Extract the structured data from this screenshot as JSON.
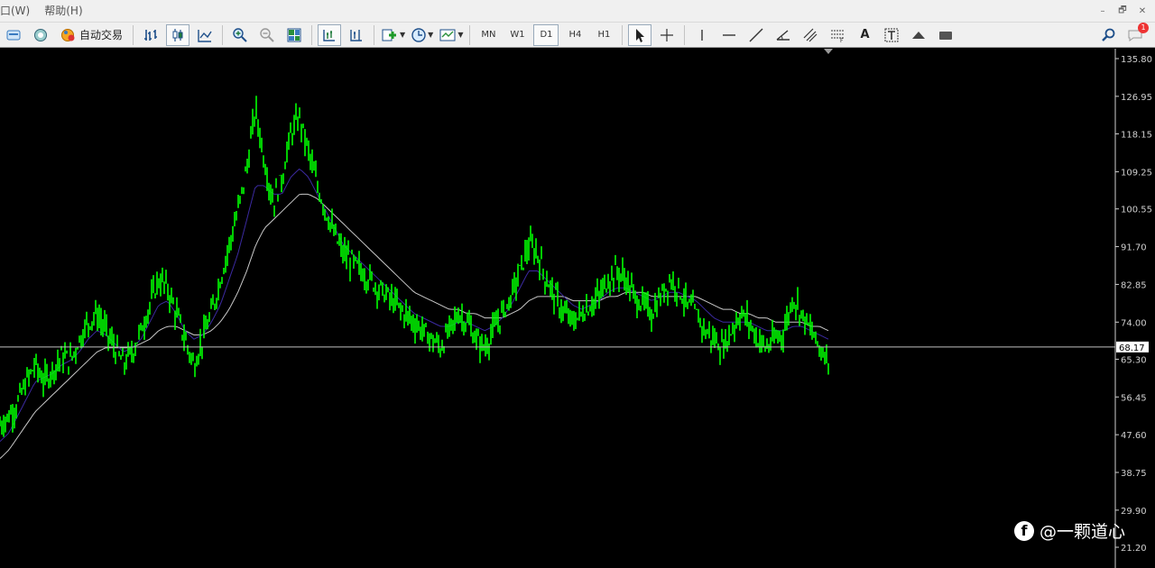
{
  "menu": {
    "items": [
      "口(W)",
      "帮助(H)"
    ],
    "window_controls": [
      "–",
      "🗗",
      "✕"
    ]
  },
  "toolbar": {
    "autotrade_label": "自动交易",
    "timeframes": [
      "MN",
      "W1",
      "D1",
      "H4",
      "H1"
    ],
    "active_timeframe": "D1",
    "text_tool_label": "A",
    "notification_count": "1"
  },
  "chart": {
    "background": "#000000",
    "price_color": "#00ff00",
    "ma_fast_color": "#3b2aa0",
    "ma_slow_color": "#c8c8c8",
    "current_price": "68.17",
    "price_axis_labels": [
      "135.80",
      "126.95",
      "118.15",
      "109.25",
      "100.55",
      "91.70",
      "82.85",
      "74.00",
      "65.30",
      "56.45",
      "47.60",
      "38.75",
      "29.90",
      "21.20"
    ]
  },
  "chart_data": {
    "type": "line",
    "ylim": [
      21.2,
      135.8
    ],
    "current_price": 68.17,
    "series": [
      {
        "values": [
          50,
          52,
          55,
          60,
          64,
          60,
          63,
          66,
          65,
          70,
          74,
          76,
          72,
          68,
          64,
          67,
          72,
          78,
          84,
          82,
          76,
          70,
          64,
          70,
          76,
          84,
          92,
          100,
          110,
          124,
          112,
          102,
          108,
          118,
          122,
          114,
          106,
          100,
          94,
          90,
          88,
          86,
          84,
          82,
          80,
          78,
          76,
          74,
          72,
          70,
          68,
          72,
          76,
          74,
          70,
          68,
          72,
          76,
          80,
          86,
          92,
          90,
          84,
          80,
          76,
          74,
          76,
          78,
          80,
          84,
          86,
          84,
          80,
          78,
          76,
          80,
          84,
          82,
          78,
          76,
          72,
          70,
          68,
          72,
          76,
          74,
          70,
          68,
          70,
          72,
          80,
          76,
          72,
          68,
          66
        ]
      },
      {
        "values": [
          46,
          48,
          52,
          56,
          60,
          61,
          62,
          64,
          65,
          67,
          70,
          72,
          71,
          69,
          67,
          68,
          70,
          74,
          78,
          79,
          76,
          72,
          70,
          71,
          74,
          78,
          84,
          90,
          98,
          106,
          106,
          104,
          104,
          108,
          110,
          108,
          104,
          100,
          96,
          92,
          90,
          88,
          86,
          84,
          82,
          80,
          78,
          76,
          75,
          74,
          73,
          73,
          74,
          74,
          73,
          72,
          73,
          75,
          78,
          82,
          86,
          86,
          84,
          82,
          80,
          78,
          77,
          78,
          79,
          81,
          82,
          82,
          81,
          80,
          79,
          80,
          81,
          81,
          80,
          79,
          77,
          75,
          74,
          74,
          74,
          74,
          73,
          72,
          72,
          72,
          73,
          73,
          72,
          71,
          70
        ]
      },
      {
        "values": [
          42,
          44,
          47,
          50,
          53,
          55,
          57,
          59,
          61,
          63,
          65,
          67,
          68,
          68,
          68,
          68,
          69,
          70,
          72,
          73,
          73,
          72,
          71,
          71,
          72,
          74,
          77,
          81,
          86,
          92,
          96,
          98,
          100,
          102,
          104,
          104,
          103,
          101,
          99,
          97,
          95,
          93,
          91,
          89,
          87,
          85,
          83,
          81,
          80,
          79,
          78,
          77,
          77,
          76,
          76,
          75,
          75,
          75,
          76,
          77,
          79,
          80,
          80,
          80,
          80,
          79,
          79,
          79,
          79,
          80,
          80,
          81,
          81,
          81,
          80,
          80,
          80,
          80,
          80,
          80,
          79,
          78,
          77,
          77,
          76,
          76,
          75,
          75,
          74,
          74,
          74,
          74,
          73,
          73,
          72
        ]
      }
    ]
  },
  "watermark": {
    "handle": "@一颗道心"
  }
}
